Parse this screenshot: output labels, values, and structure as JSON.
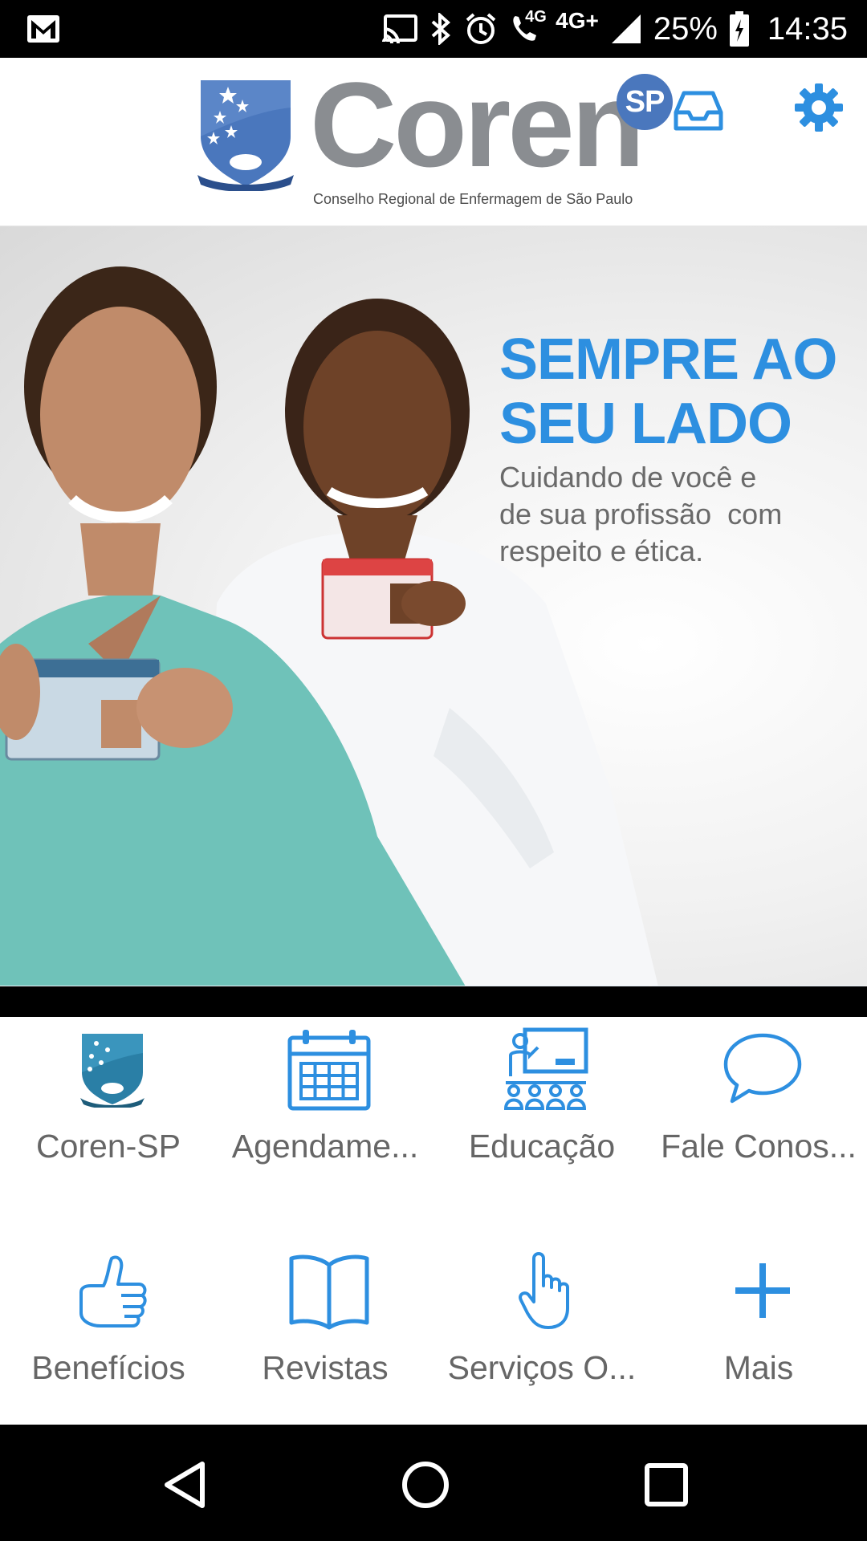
{
  "status_bar": {
    "network_4g_label": "4G",
    "network_4g_plus": "4G+",
    "battery_percent": "25%",
    "time": "14:35"
  },
  "header": {
    "logo_word_gray": "Coren",
    "logo_badge": "SP",
    "logo_subtitle": "Conselho Regional de Enfermagem de São Paulo",
    "accent_color": "#2d8fe0"
  },
  "banner": {
    "title_line1": "SEMPRE AO",
    "title_line2": "SEU LADO",
    "subtitle_line1": "Cuidando de você e",
    "subtitle_line2": "de sua profissão  com",
    "subtitle_line3": "respeito e ética.",
    "page_count": 4
  },
  "grid": {
    "items": [
      {
        "label": "Coren-SP",
        "icon": "coren-shield-icon"
      },
      {
        "label": "Agendame...",
        "icon": "calendar-icon"
      },
      {
        "label": "Educação",
        "icon": "classroom-icon"
      },
      {
        "label": "Fale Conos...",
        "icon": "chat-bubble-icon"
      },
      {
        "label": "Benefícios",
        "icon": "thumbs-up-icon"
      },
      {
        "label": "Revistas",
        "icon": "open-book-icon"
      },
      {
        "label": "Serviços O...",
        "icon": "pointing-hand-icon"
      },
      {
        "label": "Mais",
        "icon": "plus-icon"
      }
    ]
  },
  "nav_bar": {
    "buttons": [
      "back",
      "home",
      "recents"
    ]
  }
}
